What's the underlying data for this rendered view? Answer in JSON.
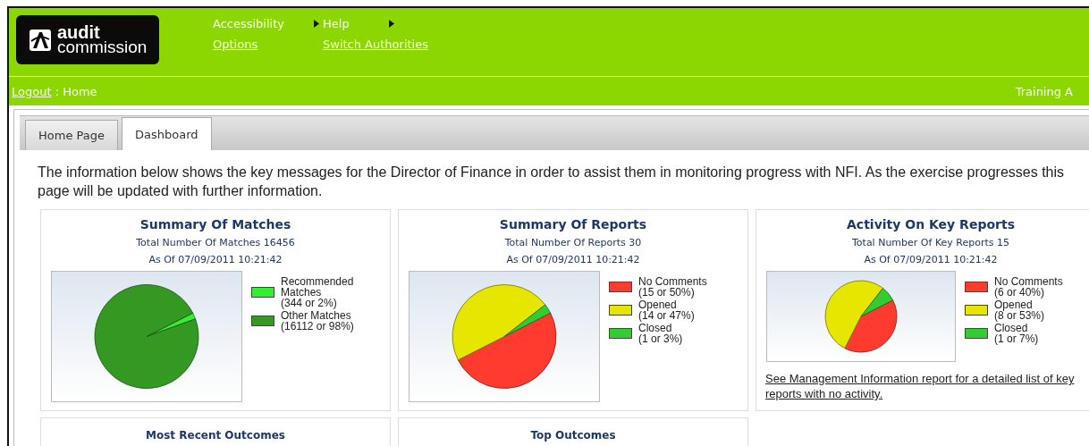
{
  "logo": {
    "line_1": "audit",
    "line_2": "commission"
  },
  "nav": [
    {
      "label": "Accessibility",
      "kind": "menu"
    },
    {
      "label": "Help",
      "kind": "menu"
    },
    {
      "label": "Options",
      "kind": "link"
    },
    {
      "label": "Switch Authorities",
      "kind": "link"
    }
  ],
  "breadcrumb": {
    "link": "Logout",
    "current": ": Home",
    "right_text": "Training A"
  },
  "tabs": [
    {
      "label": "Home Page",
      "selected": false
    },
    {
      "label": "Dashboard",
      "selected": true
    }
  ],
  "intro": "The information below shows the key messages for the Director of Finance in order to assist them in monitoring progress with NFI. As the exercise progresses this page will be updated with further information.",
  "cards": [
    {
      "title": "Summary Of Matches",
      "subtitle": "Total Number Of Matches 16456",
      "date": "As Of 07/09/2011 10:21:42",
      "chart_data": {
        "type": "pie",
        "categories": [
          "Recommended Matches",
          "Other Matches"
        ],
        "values": [
          2,
          98
        ]
      },
      "legend": [
        {
          "detail": "(344 or 2%)",
          "color": "#33ee33"
        },
        {
          "detail": "(16112 or 98%)",
          "color": "#339922"
        }
      ]
    },
    {
      "title": "Summary Of Reports",
      "subtitle": "Total Number Of Reports 30",
      "date": "As Of 07/09/2011 10:21:42",
      "chart_data": {
        "type": "pie",
        "categories": [
          "No Comments",
          "Opened",
          "Closed"
        ],
        "values": [
          50,
          47,
          3
        ]
      },
      "legend": [
        {
          "detail": "(15 or 50%)",
          "color": "#ff3b30"
        },
        {
          "detail": "(14 or 47%)",
          "color": "#e6e600"
        },
        {
          "detail": "(1 or 3%)",
          "color": "#33cc33"
        }
      ]
    },
    {
      "title": "Activity On Key Reports",
      "subtitle": "Total Number Of Key Reports 15",
      "date": "As Of 07/09/2011 10:21:42",
      "chart_data": {
        "type": "pie",
        "categories": [
          "No Comments",
          "Opened",
          "Closed"
        ],
        "values": [
          40,
          53,
          7
        ]
      },
      "legend": [
        {
          "detail": "(6 or 40%)",
          "color": "#ff3b30"
        },
        {
          "detail": "(8 or 53%)",
          "color": "#e6e600"
        },
        {
          "detail": "(1 or 7%)",
          "color": "#33cc33"
        }
      ],
      "link": "See Management Information report for a detailed list of key reports with no activity."
    }
  ],
  "bottom_cards": [
    {
      "title": "Most Recent Outcomes"
    },
    {
      "title": "Top Outcomes"
    }
  ]
}
